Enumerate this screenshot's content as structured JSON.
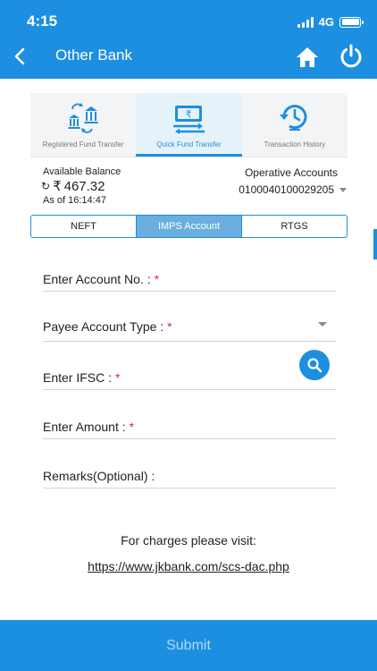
{
  "status_bar": {
    "time": "4:15",
    "network": "4G"
  },
  "header": {
    "title": "Other Bank"
  },
  "transfer_tabs": [
    {
      "label": "Registered Fund Transfer",
      "icon": "bank-transfer-icon",
      "active": false
    },
    {
      "label": "Quick Fund Transfer",
      "icon": "rupee-transfer-icon",
      "active": true
    },
    {
      "label": "Transaction History",
      "icon": "history-clock-icon",
      "active": false
    }
  ],
  "balance": {
    "label": "Available Balance",
    "currency": "₹",
    "amount": "467.32",
    "as_of": "As of 16:14:47"
  },
  "operative": {
    "label": "Operative Accounts",
    "account": "0100040100029205"
  },
  "modes": [
    {
      "label": "NEFT",
      "active": false
    },
    {
      "label": "IMPS Account",
      "active": true
    },
    {
      "label": "RTGS",
      "active": false
    }
  ],
  "form": {
    "required_mark": "*",
    "account_no": "Enter Account No. :",
    "payee_type": "Payee Account Type :",
    "ifsc": "Enter IFSC :",
    "amount": "Enter Amount :",
    "remarks": "Remarks(Optional) :"
  },
  "charges": {
    "text": "For charges please visit:",
    "link": "https://www.jkbank.com/scs-dac.php"
  },
  "submit_label": "Submit",
  "colors": {
    "primary": "#1d8fe0",
    "segment_active": "#6aafdf",
    "required": "#e02b2b"
  }
}
